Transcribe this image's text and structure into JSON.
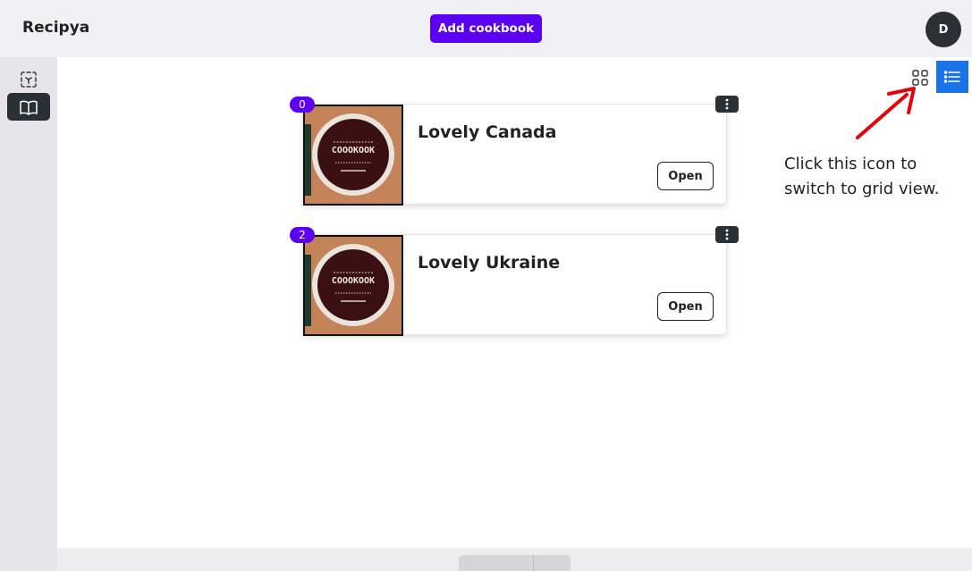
{
  "header": {
    "brand": "Recipya",
    "add_button": "Add cookbook",
    "avatar_initial": "D"
  },
  "sidebar": {
    "items": [
      {
        "icon": "scan-icon",
        "active": false
      },
      {
        "icon": "book-open-icon",
        "active": true
      }
    ]
  },
  "toolbar": {
    "view_modes": [
      {
        "icon": "grid-view-icon",
        "active": false
      },
      {
        "icon": "list-view-icon",
        "active": true
      }
    ]
  },
  "cookbooks": [
    {
      "index": "0",
      "title": "Lovely Canada",
      "open_label": "Open",
      "cover_text": "COOOKOOK"
    },
    {
      "index": "2",
      "title": "Lovely Ukraine",
      "open_label": "Open",
      "cover_text": "COOOKOOK"
    }
  ],
  "annotation": {
    "text": "Click this icon to switch to grid view.",
    "arrow_color": "#e8000b"
  },
  "colors": {
    "accent": "#5b00f5",
    "active_view": "#1a73e8",
    "dark": "#2b2f36"
  }
}
